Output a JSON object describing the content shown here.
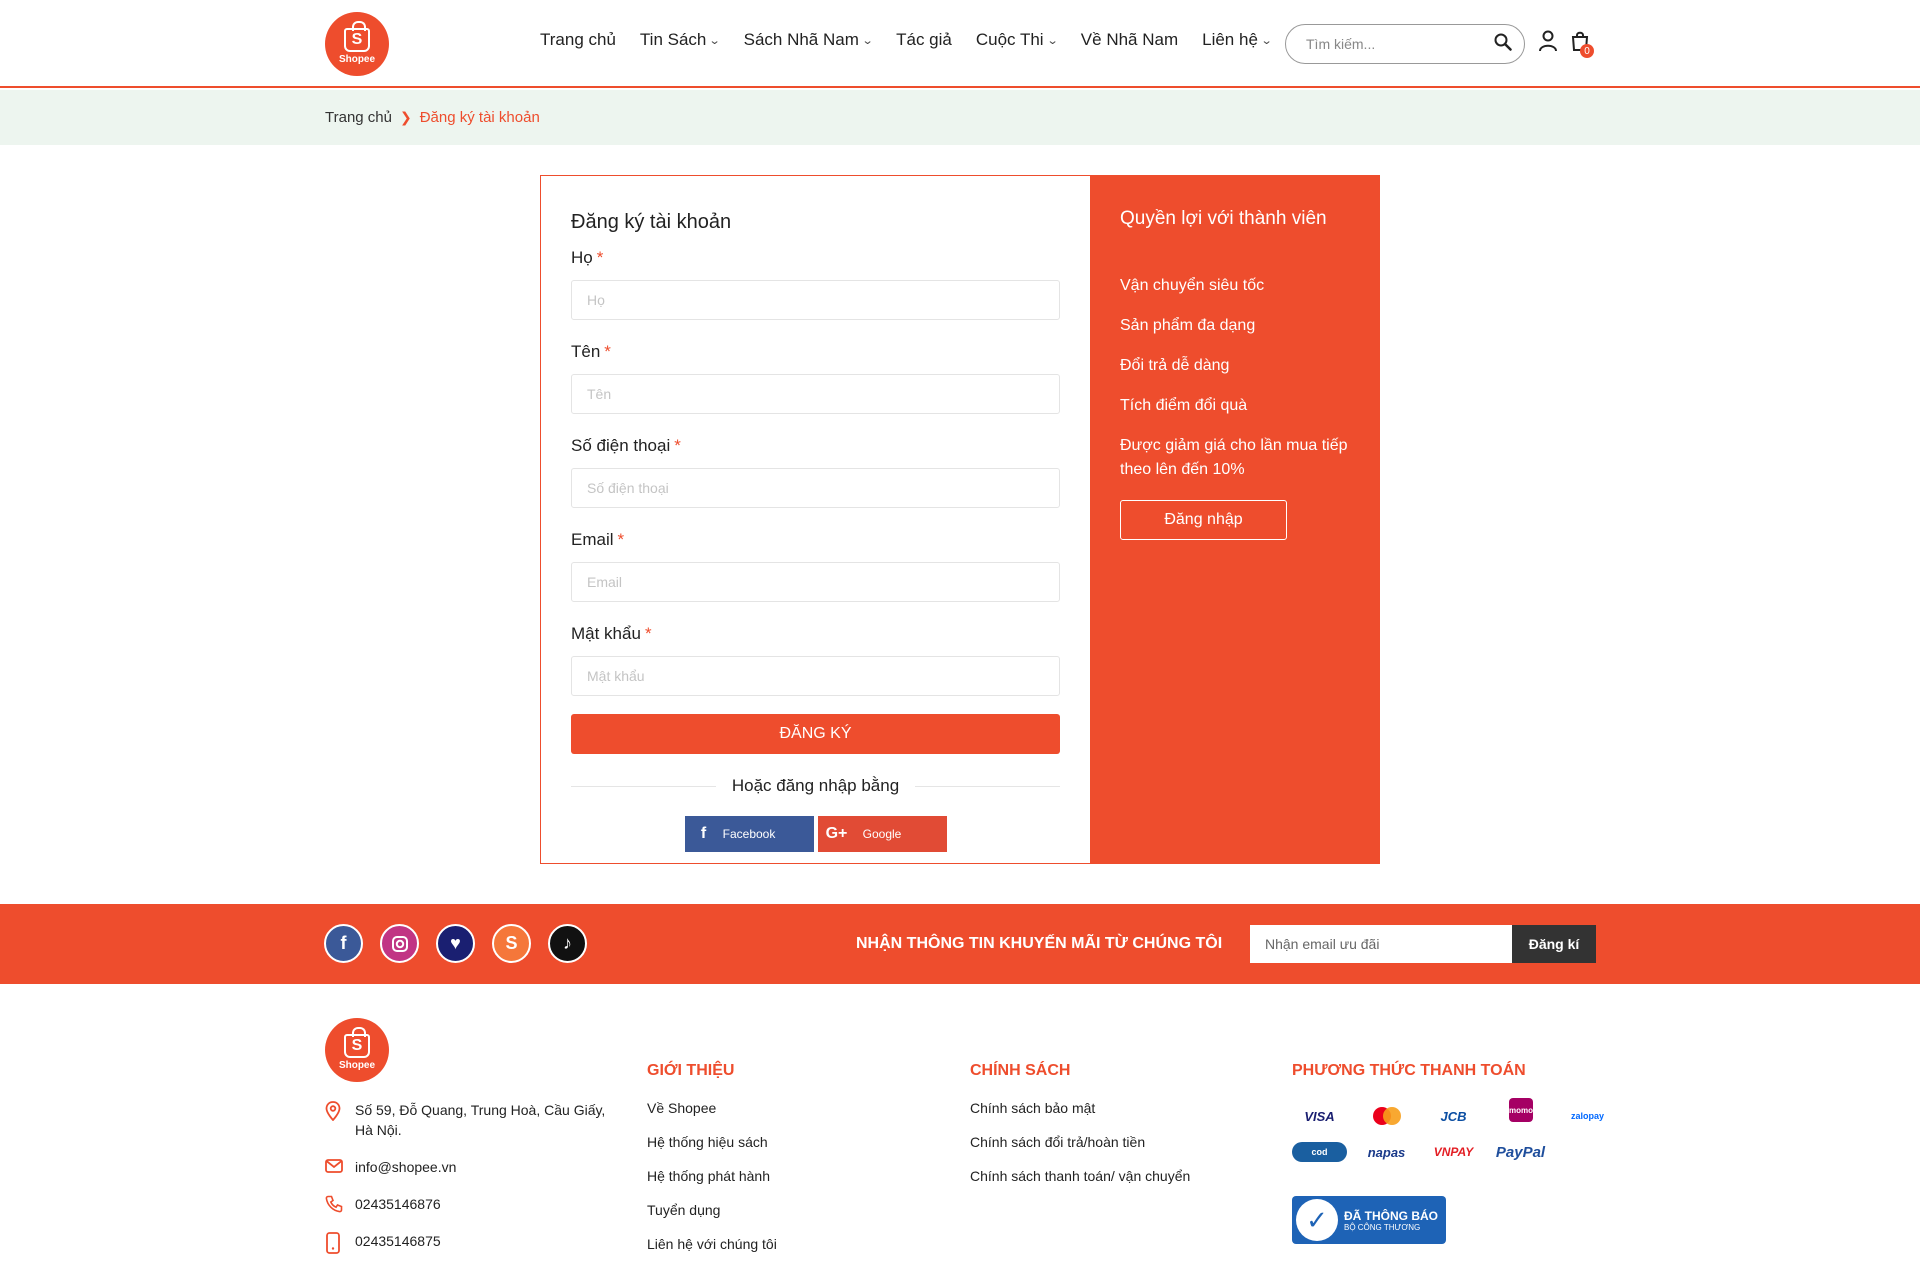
{
  "brand": {
    "logo_text": "Shopee",
    "logo_letter": "S",
    "accent": "#ee4d2d"
  },
  "nav": {
    "items": [
      {
        "label": "Trang chủ",
        "dropdown": false
      },
      {
        "label": "Tin Sách",
        "dropdown": true
      },
      {
        "label": "Sách Nhã Nam",
        "dropdown": true
      },
      {
        "label": "Tác giả",
        "dropdown": false
      },
      {
        "label": "Cuộc Thi",
        "dropdown": true
      },
      {
        "label": "Về Nhã Nam",
        "dropdown": false
      },
      {
        "label": "Liên hệ",
        "dropdown": true
      }
    ],
    "search_placeholder": "Tìm kiếm...",
    "cart_count": "0"
  },
  "breadcrumb": {
    "home": "Trang chủ",
    "current": "Đăng ký tài khoản"
  },
  "register": {
    "title": "Đăng ký tài khoản",
    "fields": [
      {
        "label": "Họ",
        "placeholder": "Họ"
      },
      {
        "label": "Tên",
        "placeholder": "Tên"
      },
      {
        "label": "Số điện thoại",
        "placeholder": "Số điện thoại"
      },
      {
        "label": "Email",
        "placeholder": "Email"
      },
      {
        "label": "Mật khẩu",
        "placeholder": "Mật khẩu"
      }
    ],
    "required_mark": "*",
    "submit_label": "Đăng ký",
    "or_text": "Hoặc đăng nhập bằng",
    "facebook_label": "Facebook",
    "google_label": "Google"
  },
  "benefits": {
    "title": "Quyền lợi với thành viên",
    "items": [
      "Vận chuyển siêu tốc",
      "Sản phẩm đa dạng",
      "Đổi trả dễ dàng",
      "Tích điểm đổi quà",
      "Được giảm giá cho lần mua tiếp theo lên đến 10%"
    ],
    "login_label": "Đăng nhập"
  },
  "promo": {
    "title": "Nhận thông tin khuyến mãi từ chúng tôi",
    "email_placeholder": "Nhận email ưu đãi",
    "button_label": "Đăng kí",
    "social_icons": [
      "facebook-icon",
      "instagram-icon",
      "heart-icon",
      "shopee-icon",
      "tiktok-icon"
    ]
  },
  "footer": {
    "address": "Số 59, Đỗ Quang, Trung Hoà, Cầu Giấy, Hà Nội.",
    "email": "info@shopee.vn",
    "phone1": "02435146876",
    "phone2": "02435146875",
    "about": {
      "title": "Giới thiệu",
      "links": [
        "Về Shopee",
        "Hệ thống hiệu sách",
        "Hệ thống phát hành",
        "Tuyển dụng",
        "Liên hệ với chúng tôi"
      ]
    },
    "policy": {
      "title": "Chính sách",
      "links": [
        "Chính sách bảo mật",
        "Chính sách đổi trả/hoàn tiền",
        "Chính sách thanh toán/ vận chuyển"
      ]
    },
    "payment": {
      "title": "Phương thức thanh toán",
      "methods": [
        "VISA",
        "mastercard",
        "JCB",
        "momo",
        "zalopay",
        "cod",
        "napas",
        "VNPAY",
        "PayPal"
      ],
      "badge_line1": "ĐÃ THÔNG BÁO",
      "badge_line2": "BỘ CÔNG THƯƠNG"
    }
  }
}
